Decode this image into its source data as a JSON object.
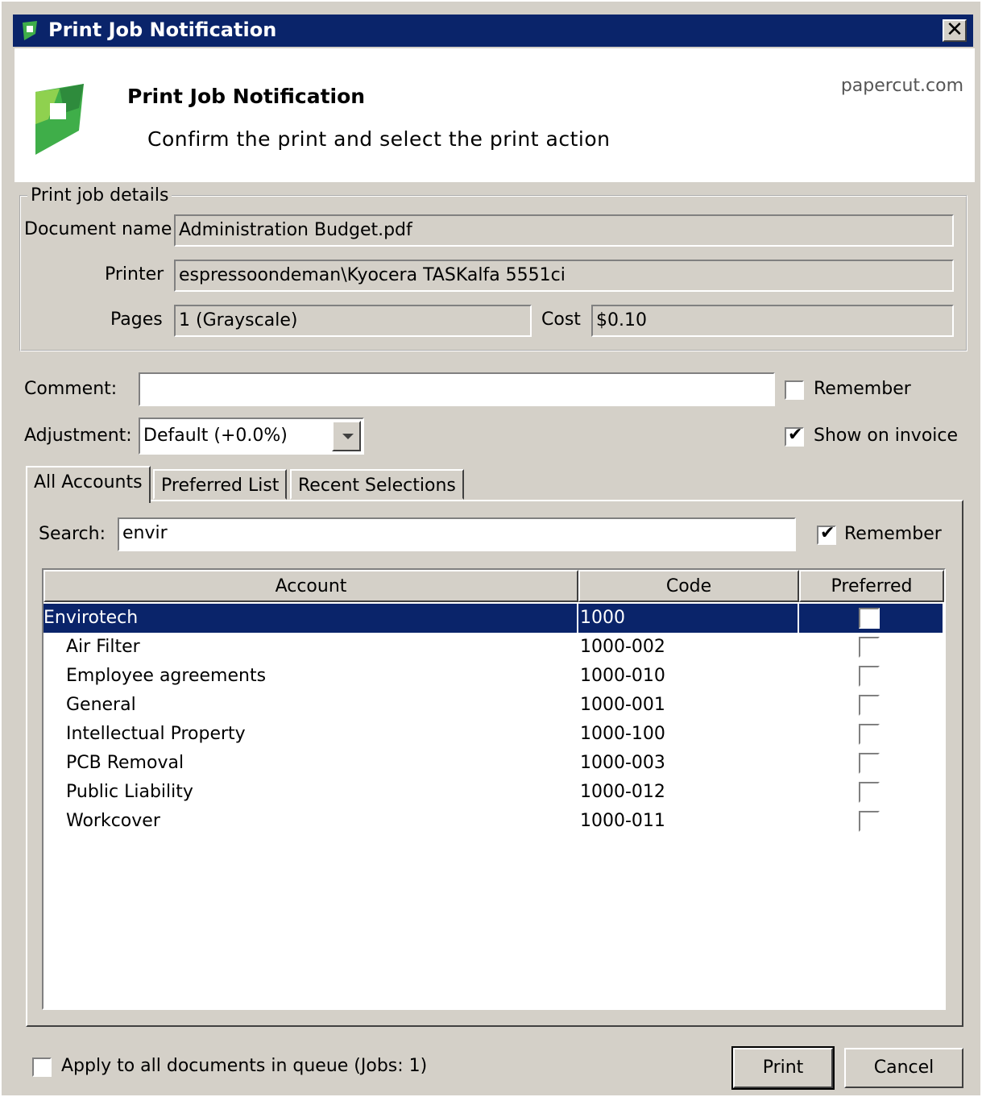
{
  "window": {
    "title": "Print Job Notification",
    "close_glyph": "✕"
  },
  "header": {
    "title": "Print Job Notification",
    "subtitle": "Confirm the print and select the print action",
    "link": "papercut.com"
  },
  "details": {
    "legend": "Print job details",
    "document_label": "Document name",
    "document_value": "Administration Budget.pdf",
    "printer_label": "Printer",
    "printer_value": "espressoondeman\\Kyocera TASKalfa 5551ci",
    "pages_label": "Pages",
    "pages_value": "1   (Grayscale)",
    "cost_label": "Cost",
    "cost_value": "$0.10"
  },
  "comment": {
    "label": "Comment:",
    "value": "",
    "remember_label": "Remember",
    "remember_checked": false
  },
  "adjustment": {
    "label": "Adjustment:",
    "selected": "Default (+0.0%)",
    "show_on_invoice_label": "Show on invoice",
    "show_on_invoice_checked": true
  },
  "tabs": [
    {
      "label": "All Accounts",
      "active": true
    },
    {
      "label": "Preferred List",
      "active": false
    },
    {
      "label": "Recent Selections",
      "active": false
    }
  ],
  "search": {
    "label": "Search:",
    "value": "envir",
    "remember_label": "Remember",
    "remember_checked": true
  },
  "table": {
    "columns": [
      "Account",
      "Code",
      "Preferred"
    ],
    "rows": [
      {
        "account": "Envirotech",
        "code": "1000",
        "preferred": false,
        "selected": true,
        "indent": false
      },
      {
        "account": "Air Filter",
        "code": "1000-002",
        "preferred": false,
        "selected": false,
        "indent": true
      },
      {
        "account": "Employee agreements",
        "code": "1000-010",
        "preferred": false,
        "selected": false,
        "indent": true
      },
      {
        "account": "General",
        "code": "1000-001",
        "preferred": false,
        "selected": false,
        "indent": true
      },
      {
        "account": "Intellectual Property",
        "code": "1000-100",
        "preferred": false,
        "selected": false,
        "indent": true
      },
      {
        "account": "PCB Removal",
        "code": "1000-003",
        "preferred": false,
        "selected": false,
        "indent": true
      },
      {
        "account": "Public Liability",
        "code": "1000-012",
        "preferred": false,
        "selected": false,
        "indent": true
      },
      {
        "account": "Workcover",
        "code": "1000-011",
        "preferred": false,
        "selected": false,
        "indent": true
      }
    ]
  },
  "footer": {
    "apply_all_label": "Apply to all documents in queue (Jobs: 1)",
    "apply_all_checked": false,
    "print_label": "Print",
    "cancel_label": "Cancel"
  },
  "colors": {
    "titlebar": "#0a246a",
    "selection": "#0a246a",
    "face": "#d4d0c8",
    "logo_green": "#3fae49"
  },
  "icons": {
    "app_icon": "papercut-logo-icon",
    "check_glyph": "✔"
  }
}
